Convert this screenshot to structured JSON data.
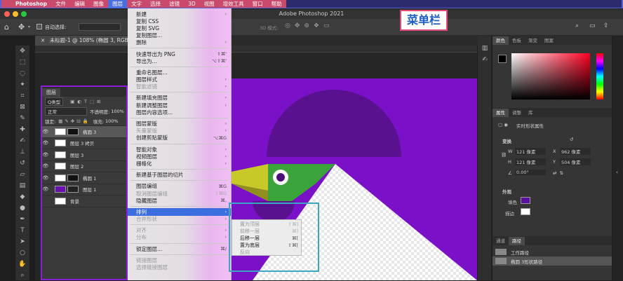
{
  "menubar": {
    "items": [
      "Photoshop",
      "文件",
      "编辑",
      "图像",
      "图层",
      "文字",
      "选择",
      "滤镜",
      "3D",
      "视图",
      "增效工具",
      "窗口",
      "帮助"
    ],
    "active_index": 4
  },
  "titlebar": {
    "title": "Adobe Photoshop 2021"
  },
  "options": {
    "auto_select_label": "自动选择:",
    "mode_3d": "3D 模式:"
  },
  "document": {
    "tab_title": "未标题-1 @ 108% (椭圆 3, RGB/8*) *"
  },
  "annotation": {
    "text": "菜单栏"
  },
  "layers_panel": {
    "title": "图层",
    "kind_filter": "Q类型",
    "blend_mode": "正常",
    "opacity_label": "不透明度:",
    "opacity_value": "100%",
    "lock_label": "锁定:",
    "fill_label": "填充:",
    "fill_value": "100%",
    "layers": [
      {
        "name": "椭圆 3",
        "selected": true
      },
      {
        "name": "图层 3 拷贝",
        "selected": false
      },
      {
        "name": "图层 3",
        "selected": false
      },
      {
        "name": "图层 2",
        "selected": false
      },
      {
        "name": "椭圆 1",
        "selected": false
      },
      {
        "name": "图层 1",
        "selected": false
      },
      {
        "name": "背景",
        "selected": false
      }
    ]
  },
  "layer_menu": {
    "items": [
      {
        "label": "新建",
        "shortcut": "",
        "submenu": true,
        "disabled": false
      },
      {
        "label": "复制 CSS",
        "shortcut": "",
        "submenu": false,
        "disabled": false
      },
      {
        "label": "复制 SVG",
        "shortcut": "",
        "submenu": false,
        "disabled": false
      },
      {
        "label": "复制图层...",
        "shortcut": "",
        "submenu": false,
        "disabled": false
      },
      {
        "label": "删除",
        "shortcut": "",
        "submenu": true,
        "disabled": false
      },
      {
        "sep": true
      },
      {
        "label": "快速导出为 PNG",
        "shortcut": "⇧⌘'",
        "submenu": false,
        "disabled": false
      },
      {
        "label": "导出为...",
        "shortcut": "⌥⇧⌘'",
        "submenu": false,
        "disabled": false
      },
      {
        "sep": true
      },
      {
        "label": "重命名图层...",
        "shortcut": "",
        "submenu": false,
        "disabled": false
      },
      {
        "label": "图层样式",
        "shortcut": "",
        "submenu": true,
        "disabled": false
      },
      {
        "label": "智能滤镜",
        "shortcut": "",
        "submenu": true,
        "disabled": true
      },
      {
        "sep": true
      },
      {
        "label": "新建填充图层",
        "shortcut": "",
        "submenu": true,
        "disabled": false
      },
      {
        "label": "新建调整图层",
        "shortcut": "",
        "submenu": true,
        "disabled": false
      },
      {
        "label": "图层内容选项...",
        "shortcut": "",
        "submenu": false,
        "disabled": false
      },
      {
        "sep": true
      },
      {
        "label": "图层蒙版",
        "shortcut": "",
        "submenu": true,
        "disabled": false
      },
      {
        "label": "矢量蒙版",
        "shortcut": "",
        "submenu": true,
        "disabled": true
      },
      {
        "label": "创建剪贴蒙版",
        "shortcut": "⌥⌘G",
        "submenu": false,
        "disabled": false
      },
      {
        "sep": true
      },
      {
        "label": "智能对象",
        "shortcut": "",
        "submenu": true,
        "disabled": false
      },
      {
        "label": "视频图层",
        "shortcut": "",
        "submenu": true,
        "disabled": false
      },
      {
        "label": "栅格化",
        "shortcut": "",
        "submenu": true,
        "disabled": false
      },
      {
        "sep": true
      },
      {
        "label": "新建基于图层的切片",
        "shortcut": "",
        "submenu": false,
        "disabled": false
      },
      {
        "sep": true
      },
      {
        "label": "图层编组",
        "shortcut": "⌘G",
        "submenu": false,
        "disabled": false
      },
      {
        "label": "取消图层编组",
        "shortcut": "⇧⌘G",
        "submenu": false,
        "disabled": true
      },
      {
        "label": "隐藏图层",
        "shortcut": "⌘,",
        "submenu": false,
        "disabled": false
      },
      {
        "sep": true
      },
      {
        "label": "排列",
        "shortcut": "",
        "submenu": true,
        "disabled": false,
        "highlight": true
      },
      {
        "label": "合并形状",
        "shortcut": "",
        "submenu": true,
        "disabled": true
      },
      {
        "sep": true
      },
      {
        "label": "对齐",
        "shortcut": "",
        "submenu": true,
        "disabled": true
      },
      {
        "label": "分布",
        "shortcut": "",
        "submenu": true,
        "disabled": true
      },
      {
        "sep": true
      },
      {
        "label": "锁定图层...",
        "shortcut": "⌘/",
        "submenu": false,
        "disabled": false
      },
      {
        "sep": true
      },
      {
        "label": "链接图层",
        "shortcut": "",
        "submenu": false,
        "disabled": true
      },
      {
        "label": "选择链接图层",
        "shortcut": "",
        "submenu": false,
        "disabled": true
      }
    ]
  },
  "arrange_submenu": {
    "items": [
      {
        "label": "置为顶层",
        "shortcut": "⇧⌘]",
        "disabled": true
      },
      {
        "label": "前移一层",
        "shortcut": "⌘]",
        "disabled": true
      },
      {
        "label": "后移一层",
        "shortcut": "⌘[",
        "disabled": false
      },
      {
        "label": "置为底层",
        "shortcut": "⇧⌘[",
        "disabled": false
      },
      {
        "label": "反向",
        "shortcut": "",
        "disabled": true
      }
    ]
  },
  "color_panel": {
    "tabs": [
      "颜色",
      "色板",
      "渐变",
      "图案"
    ]
  },
  "properties_panel": {
    "tabs": [
      "属性",
      "调整",
      "库"
    ],
    "kind": "实时形状属性",
    "transform_title": "变换",
    "w_label": "W",
    "w_value": "121 像素",
    "x_label": "X",
    "x_value": "962 像素",
    "h_label": "H",
    "h_value": "121 像素",
    "y_label": "Y",
    "y_value": "504 像素",
    "angle_value": "0.00°",
    "appearance_title": "外观",
    "fill_label": "填色",
    "stroke_label": "描边",
    "fill_color": "#5b0f9e"
  },
  "paths_panel": {
    "tabs": [
      "通道",
      "路径"
    ],
    "paths": [
      "工作路径",
      "椭圆 3形状路径"
    ]
  }
}
